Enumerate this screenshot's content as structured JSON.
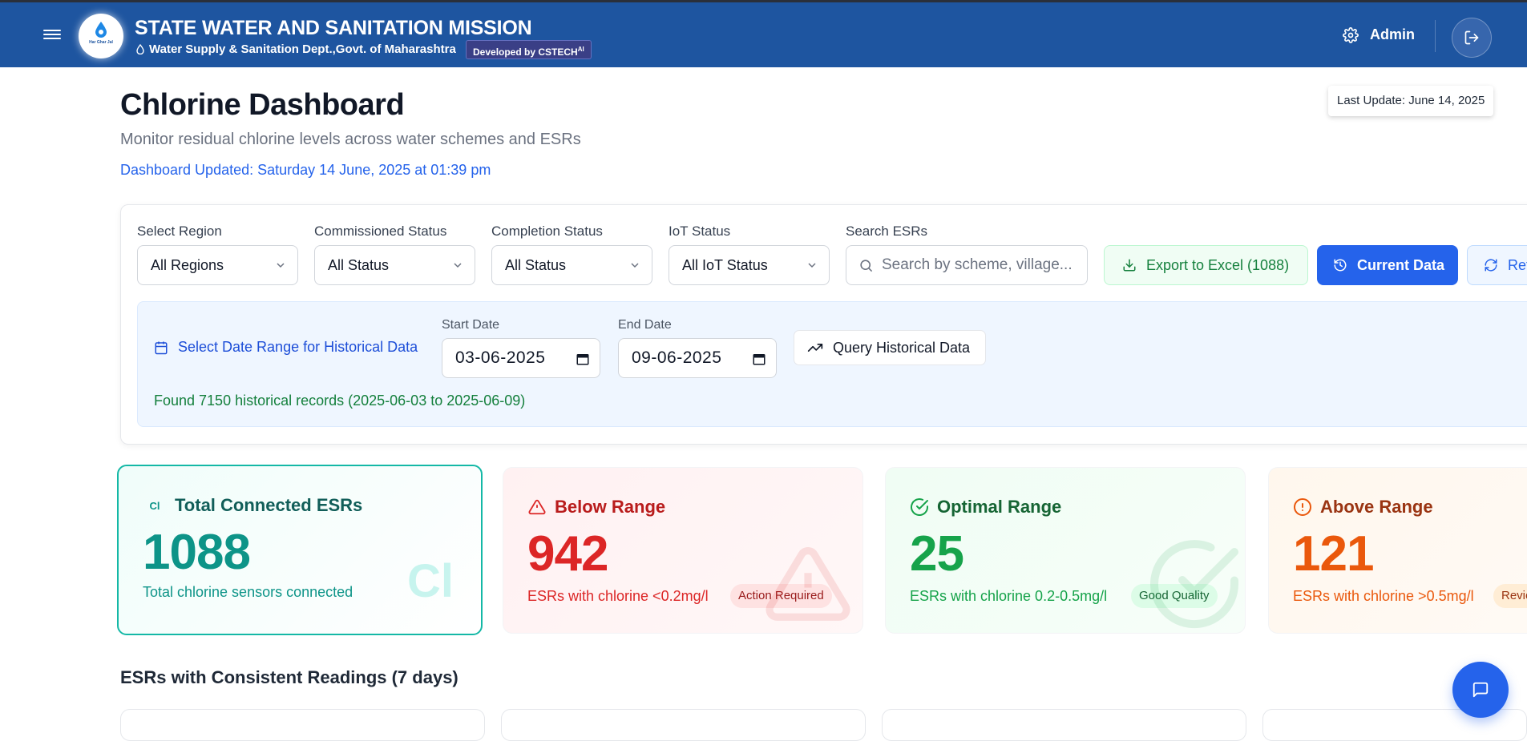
{
  "header": {
    "title": "STATE WATER AND SANITATION MISSION",
    "subtitle": "Water Supply & Sanitation Dept.,Govt. of Maharashtra",
    "developed_by": "Developed by CSTECH",
    "developed_by_sup": "AI",
    "logo_text": "Har Ghar Jal",
    "admin_label": "Admin"
  },
  "page": {
    "title": "Chlorine Dashboard",
    "subtitle": "Monitor residual chlorine levels across water schemes and ESRs",
    "updated": "Dashboard Updated: Saturday 14 June, 2025 at 01:39 pm",
    "last_update": "Last Update: June 14, 2025"
  },
  "filters": {
    "region": {
      "label": "Select Region",
      "value": "All Regions"
    },
    "commissioned": {
      "label": "Commissioned Status",
      "value": "All Status"
    },
    "completion": {
      "label": "Completion Status",
      "value": "All Status"
    },
    "iot": {
      "label": "IoT Status",
      "value": "All IoT Status"
    },
    "search": {
      "label": "Search ESRs",
      "placeholder": "Search by scheme, village..."
    },
    "export_label": "Export to Excel (1088)",
    "current_label": "Current Data",
    "refresh_label": "Refresh"
  },
  "historical": {
    "label": "Select Date Range for Historical Data",
    "start_label": "Start Date",
    "start_value": "03-06-2025",
    "end_label": "End Date",
    "end_value": "09-06-2025",
    "query_label": "Query Historical Data",
    "found_text": "Found 7150 historical records (2025-06-03 to 2025-06-09)"
  },
  "cards": {
    "total": {
      "icon_text": "Cl",
      "title": "Total Connected ESRs",
      "value": "1088",
      "desc": "Total chlorine sensors connected",
      "watermark": "Cl"
    },
    "below": {
      "title": "Below Range",
      "value": "942",
      "desc": "ESRs with chlorine <0.2mg/l",
      "badge": "Action Required"
    },
    "optimal": {
      "title": "Optimal Range",
      "value": "25",
      "desc": "ESRs with chlorine 0.2-0.5mg/l",
      "badge": "Good Quality"
    },
    "above": {
      "title": "Above Range",
      "value": "121",
      "desc": "ESRs with chlorine >0.5mg/l",
      "badge": "Review"
    }
  },
  "sections": {
    "consistent": "ESRs with Consistent Readings (7 days)"
  },
  "colors": {
    "header_bg": "#1e55a0",
    "primary": "#2563eb",
    "teal": "#0d9488",
    "red": "#dc2626",
    "green": "#16a34a",
    "orange": "#ea580c"
  }
}
